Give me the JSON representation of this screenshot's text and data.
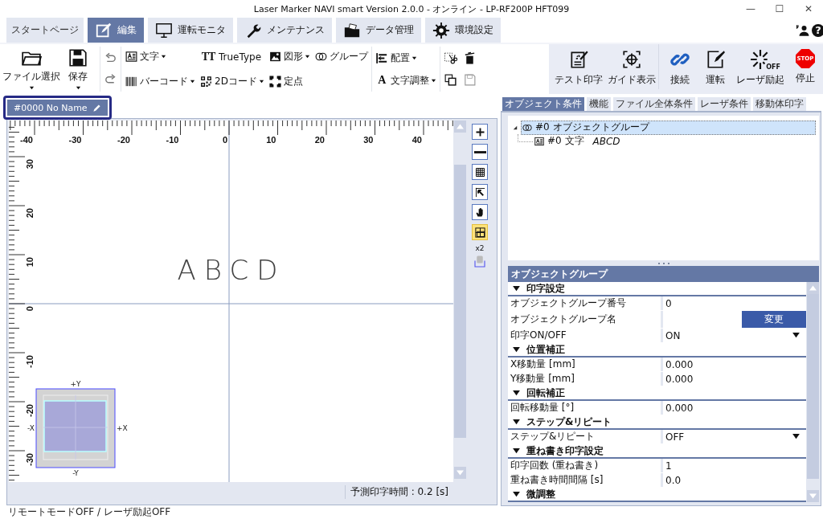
{
  "window": {
    "title": "Laser Marker NAVI smart  Version 2.0.0  - オンライン  - LP-RF200P  HFT099",
    "controls": [
      "—",
      "☐",
      "✕"
    ]
  },
  "help_glyph": "?",
  "tabs": [
    {
      "label": "スタートページ",
      "selected": false
    },
    {
      "label": "編集",
      "selected": true
    },
    {
      "label": "運転モニタ",
      "selected": false
    },
    {
      "label": "メンテナンス",
      "selected": false
    },
    {
      "label": "データ管理",
      "selected": false
    },
    {
      "label": "環境設定",
      "selected": false
    }
  ],
  "ribbon": {
    "file": [
      {
        "label": "ファイル選択",
        "dropdown": true
      },
      {
        "label": "保存",
        "dropdown": true
      }
    ],
    "objects": [
      {
        "label": "文字",
        "dropdown": true
      },
      {
        "glyph": "TT",
        "label": "TrueType",
        "dropdown": false
      },
      {
        "label": "図形",
        "dropdown": true
      },
      {
        "label": "グループ",
        "dropdown": false
      },
      {
        "label": "バーコード",
        "dropdown": true
      },
      {
        "label": "2Dコード",
        "dropdown": true
      },
      {
        "label": "定点",
        "dropdown": false
      }
    ],
    "arrange": [
      {
        "label": "配置",
        "dropdown": true
      },
      {
        "glyph": "A",
        "label": "文字調整",
        "dropdown": true
      }
    ],
    "test_actions": [
      {
        "label": "テスト印字"
      },
      {
        "label": "ガイド表示"
      }
    ],
    "run_actions": [
      {
        "label": "接続"
      },
      {
        "label": "運転"
      },
      {
        "label": "レーザ励起",
        "glyph": "OFF"
      },
      {
        "label": "停止",
        "glyph": "STOP"
      }
    ]
  },
  "document_tab": {
    "label": "#0000 No Name"
  },
  "canvas": {
    "x_labels": [
      "-40",
      "-30",
      "-20",
      "-10",
      "0",
      "10",
      "20",
      "30",
      "40"
    ],
    "y_labels": [
      "30",
      "20",
      "10",
      "0",
      "-10",
      "-20",
      "-30"
    ],
    "text": "ABCD",
    "preview": {
      "top": "+Y",
      "bottom": "-Y",
      "left": "-X",
      "right": "+X"
    },
    "tools": [
      {
        "selected": false
      },
      {
        "selected": false
      },
      {
        "selected": false
      },
      {
        "selected": false
      },
      {
        "selected": false
      },
      {
        "selected": true
      }
    ],
    "zoom": "x2",
    "estimate": "予測印字時間 : 0.2 [s]"
  },
  "status_bar": "リモートモードOFF / レーザ励起OFF",
  "panel_tabs": [
    {
      "label": "オブジェクト条件",
      "selected": true
    },
    {
      "label": "機能",
      "selected": false
    },
    {
      "label": "ファイル全体条件",
      "selected": false
    },
    {
      "label": "レーザ条件",
      "selected": false
    },
    {
      "label": "移動体印字",
      "selected": false
    }
  ],
  "tree": [
    {
      "label": "#0 オブジェクトグループ",
      "selected": true,
      "expanded": true,
      "children": [
        {
          "label": "#0 文字",
          "value": "ABCD",
          "selected": false
        }
      ]
    }
  ],
  "properties": {
    "title": "オブジェクトグループ",
    "rows": [
      {
        "kind": "section",
        "label": "印字設定"
      },
      {
        "kind": "value",
        "label": "オブジェクトグループ番号",
        "value": "0"
      },
      {
        "kind": "button",
        "label": "オブジェクトグループ名",
        "button": "変更"
      },
      {
        "kind": "select",
        "label": "印字ON/OFF",
        "value": "ON"
      },
      {
        "kind": "section",
        "label": "位置補正"
      },
      {
        "kind": "value",
        "label": "X移動量 [mm]",
        "value": "0.000"
      },
      {
        "kind": "value",
        "label": "Y移動量 [mm]",
        "value": "0.000"
      },
      {
        "kind": "section",
        "label": "回転補正"
      },
      {
        "kind": "value",
        "label": "回転移動量 [°]",
        "value": "0.000"
      },
      {
        "kind": "section",
        "label": "ステップ&リピート"
      },
      {
        "kind": "select",
        "label": "ステップ&リピート",
        "value": "OFF"
      },
      {
        "kind": "section",
        "label": "重ね書き印字設定"
      },
      {
        "kind": "value",
        "label": "印字回数 (重ね書き)",
        "value": "1"
      },
      {
        "kind": "value",
        "label": "重ね書き時間間隔 [s]",
        "value": "0.0"
      },
      {
        "kind": "section",
        "label": "微調整"
      }
    ]
  }
}
